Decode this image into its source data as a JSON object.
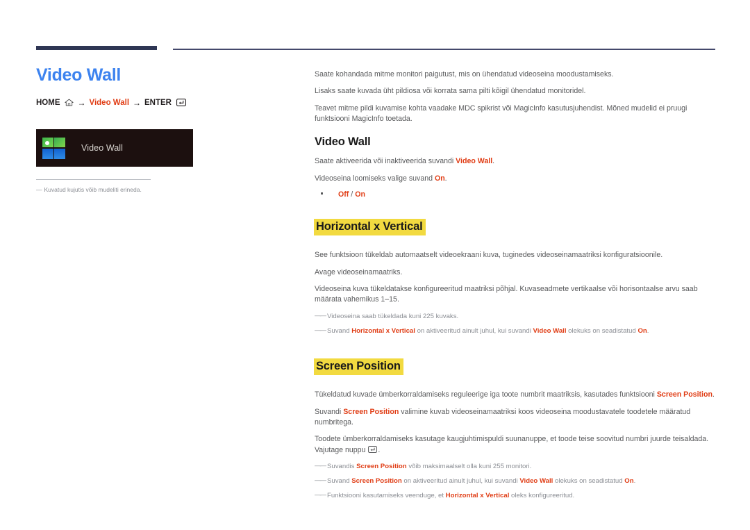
{
  "page": {
    "title": "Video Wall",
    "title_color": "#3d83ef",
    "accent_color": "#e03c14",
    "highlight_color": "#f2da40",
    "rule_color": "#2e3654"
  },
  "breadcrumb": {
    "home_label": "HOME",
    "home_icon": "home-icon",
    "arrow": "→",
    "target_label": "Video Wall",
    "enter_label": "ENTER",
    "enter_icon": "enter-key-icon"
  },
  "menu_preview": {
    "icon": "video-wall-grid-icon",
    "label": "Video Wall"
  },
  "left_footnote": {
    "dash": "—",
    "text": "Kuvatud kujutis võib mudeliti erineda."
  },
  "intro": {
    "p1": "Saate kohandada mitme monitori paigutust, mis on ühendatud videoseina moodustamiseks.",
    "p2": "Lisaks saate kuvada üht pildiosa või korrata sama pilti kõigil ühendatud monitoridel.",
    "p3": "Teavet mitme pildi kuvamise kohta vaadake MDC spikrist või MagicInfo kasutusjuhendist. Mõned mudelid ei pruugi funktsiooni MagicInfo toetada."
  },
  "section_video_wall": {
    "heading": "Video Wall",
    "highlighted": false,
    "p1_pre": "Saate aktiveerida või inaktiveerida suvandi ",
    "p1_accent": "Video Wall",
    "p1_post": ".",
    "p2_pre": "Videoseina loomiseks valige suvand ",
    "p2_accent": "On",
    "p2_post": ".",
    "option_off": "Off",
    "option_sep": "/",
    "option_on": "On"
  },
  "section_horizontal_vertical": {
    "heading": "Horizontal x Vertical",
    "highlighted": true,
    "p1": "See funktsioon tükeldab automaatselt videoekraani kuva, tuginedes videoseinamaatriksi konfiguratsioonile.",
    "p2": "Avage videoseinamaatriks.",
    "p3": "Videoseina kuva tükeldatakse konfigureeritud maatriksi põhjal. Kuvaseadmete vertikaalse või horisontaalse arvu saab määrata vahemikus 1–15.",
    "note1": "Videoseina saab tükeldada kuni 225 kuvaks.",
    "note2_pre": "Suvand ",
    "note2_a1": "Horizontal x Vertical",
    "note2_mid": " on aktiveeritud ainult juhul, kui suvandi ",
    "note2_a2": "Video Wall",
    "note2_mid2": " olekuks on seadistatud ",
    "note2_a3": "On",
    "note2_post": "."
  },
  "section_screen_position": {
    "heading": "Screen Position",
    "highlighted": true,
    "p1_pre": "Tükeldatud kuvade ümberkorraldamiseks reguleerige iga toote numbrit maatriksis, kasutades funktsiooni ",
    "p1_accent": "Screen Position",
    "p1_post": ".",
    "p2_pre": "Suvandi ",
    "p2_accent": "Screen Position",
    "p2_post": " valimine kuvab videoseinamaatriksi koos videoseina moodustavatele toodetele määratud numbritega.",
    "p3_pre": "Toodete ümberkorraldamiseks kasutage kaugjuhtimispuldi suunanuppe, et toode teise soovitud numbri juurde teisaldada. Vajutage nuppu ",
    "p3_post": ".",
    "p3_icon": "enter-key-icon",
    "note1_pre": "Suvandis ",
    "note1_a1": "Screen Position",
    "note1_post": " võib maksimaalselt olla kuni 255 monitori.",
    "note2_pre": "Suvand ",
    "note2_a1": "Screen Position",
    "note2_mid": " on aktiveeritud ainult juhul, kui suvandi ",
    "note2_a2": "Video Wall",
    "note2_mid2": " olekuks on seadistatud ",
    "note2_a3": "On",
    "note2_post": ".",
    "note3_pre": "Funktsiooni kasutamiseks veenduge, et ",
    "note3_a1": "Horizontal x Vertical",
    "note3_post": " oleks konfigureeritud."
  }
}
